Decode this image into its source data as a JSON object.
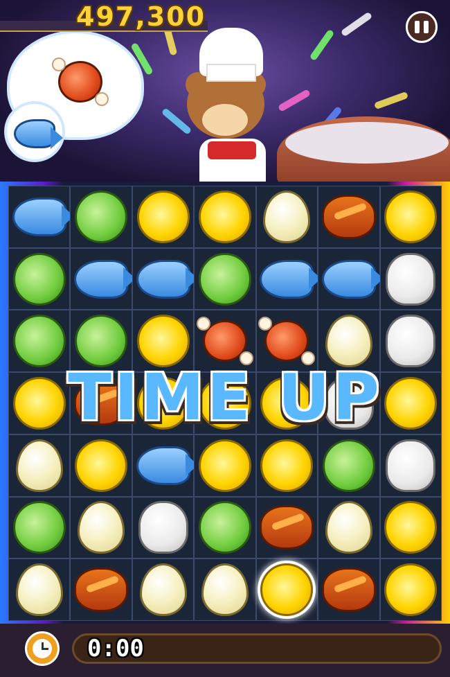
{
  "hud": {
    "score": "497,300",
    "timer": "0:00",
    "pause_icon": "pause-icon",
    "clock_icon": "clock-icon"
  },
  "order": {
    "requested_items": [
      "meat",
      "fish"
    ]
  },
  "banner": {
    "text": "TIME UP"
  },
  "board": {
    "rows": [
      [
        "fish",
        "cabbage",
        "pasta",
        "pasta",
        "egg",
        "bread",
        "pasta"
      ],
      [
        "cabbage",
        "fish",
        "fish",
        "cabbage",
        "fish",
        "fish",
        "rice"
      ],
      [
        "cabbage",
        "cabbage",
        "pasta",
        "meat",
        "meat",
        "egg",
        "rice"
      ],
      [
        "pasta",
        "bread",
        "pasta",
        "pasta",
        "pasta",
        "rice",
        "pasta"
      ],
      [
        "egg",
        "pasta",
        "fish",
        "pasta",
        "pasta",
        "cabbage",
        "rice"
      ],
      [
        "cabbage",
        "egg",
        "rice",
        "cabbage",
        "bread",
        "egg",
        "pasta"
      ],
      [
        "egg",
        "bread",
        "egg",
        "egg",
        "pasta",
        "bread",
        "pasta"
      ]
    ],
    "selected": {
      "row": 6,
      "col": 4
    }
  },
  "colors": {
    "score": "#ffd23a",
    "banner": "#5ab8ff",
    "clock": "#f0a020"
  }
}
